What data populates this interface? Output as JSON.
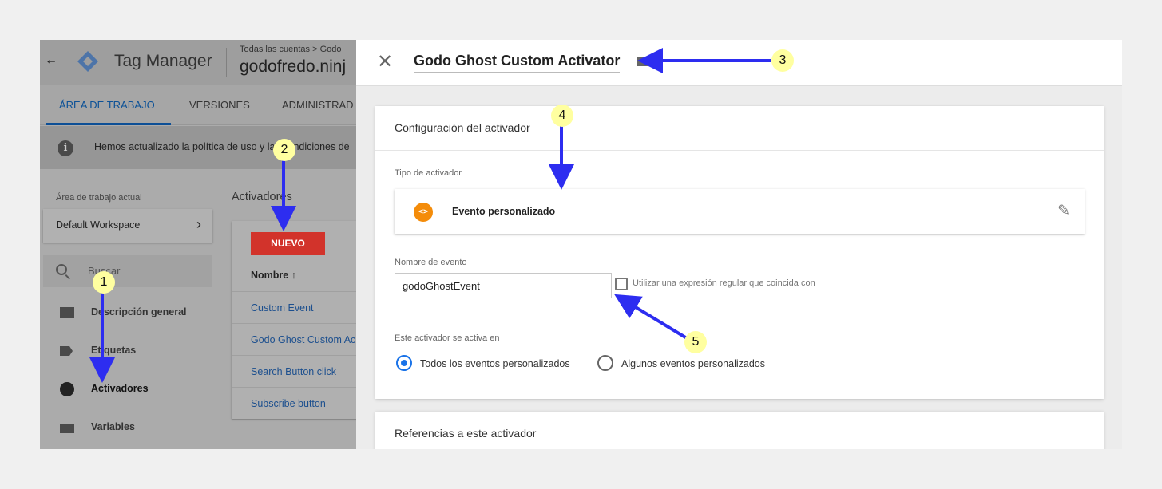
{
  "app": {
    "back_arrow": "←",
    "product": "Tag Manager",
    "breadcrumb": "Todas las cuentas > Godo",
    "container": "godofredo.ninj"
  },
  "tabs": [
    {
      "label": "ÁREA DE TRABAJO"
    },
    {
      "label": "VERSIONES"
    },
    {
      "label": "ADMINISTRAD"
    }
  ],
  "notice": {
    "icon_text": "i",
    "text": "Hemos actualizado la política de uso y las condiciones de"
  },
  "workspace": {
    "label": "Área de trabajo actual",
    "name": "Default Workspace",
    "chevron": "›"
  },
  "search": {
    "placeholder": "Buscar"
  },
  "nav": [
    {
      "label": "Descripción general",
      "icon": "overview-icon"
    },
    {
      "label": "Etiquetas",
      "icon": "tag-icon"
    },
    {
      "label": "Activadores",
      "icon": "trigger-icon"
    },
    {
      "label": "Variables",
      "icon": "variables-icon"
    }
  ],
  "triggers": {
    "title": "Activadores",
    "new_button": "NUEVO",
    "column": "Nombre ↑",
    "rows": [
      "Custom Event",
      "Godo Ghost Custom Ac",
      "Search Button click",
      "Subscribe button"
    ]
  },
  "panel": {
    "close": "✕",
    "title": "Godo Ghost Custom Activator",
    "config_title": "Configuración del activador",
    "type_label": "Tipo de activador",
    "type_icon": "<>",
    "type_name": "Evento personalizado",
    "edit_icon": "✎",
    "event_label": "Nombre de evento",
    "event_value": "godoGhostEvent",
    "regex_label": "Utilizar una expresión regular que coincida con",
    "regex_checked": false,
    "fires_label": "Este activador se activa en",
    "options": [
      {
        "label": "Todos los eventos personalizados",
        "selected": true
      },
      {
        "label": "Algunos eventos personalizados",
        "selected": false
      }
    ],
    "references_title": "Referencias a este activador"
  },
  "annotations": [
    "1",
    "2",
    "3",
    "4",
    "5"
  ],
  "colors": {
    "accent_blue": "#1a73e8",
    "arrow": "#2d2df0",
    "new_button": "#d2332b",
    "badge": "#ffffa0",
    "trigger_icon": "#f48c0a"
  }
}
